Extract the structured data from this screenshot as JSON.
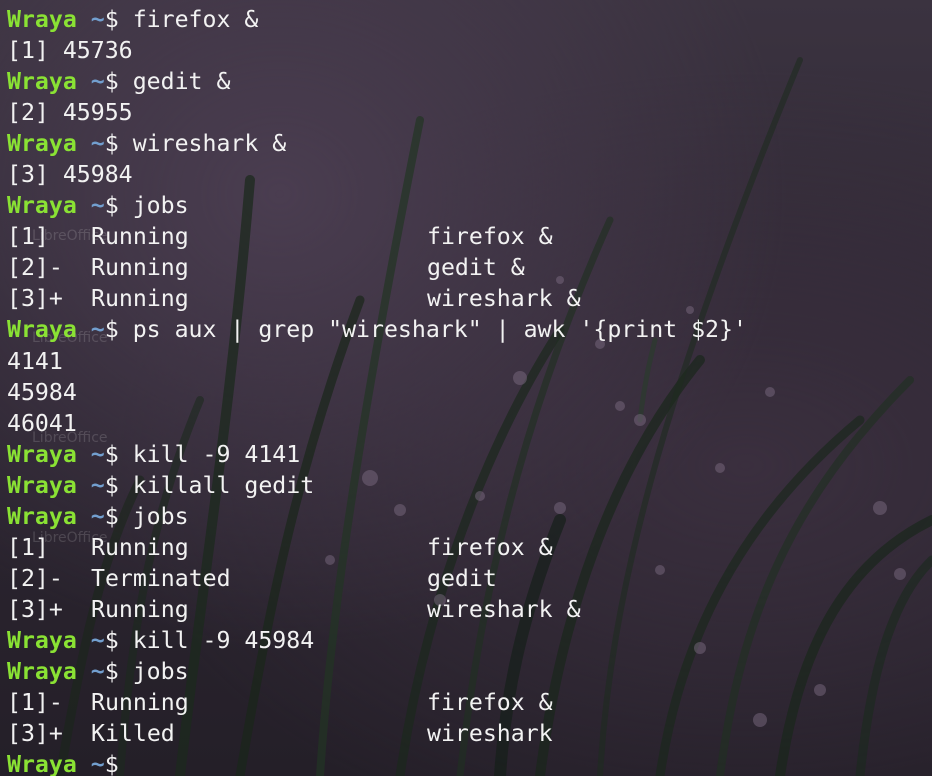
{
  "terminal": {
    "prompt_user": "Wraya",
    "prompt_dir": "~",
    "prompt_symbol": "$",
    "colors": {
      "user": "#8ae234",
      "dir": "#729fcf",
      "text": "#f2f2f2"
    },
    "lines": [
      {
        "type": "cmd",
        "text": "firefox &"
      },
      {
        "type": "out",
        "text": "[1] 45736"
      },
      {
        "type": "cmd",
        "text": "gedit &"
      },
      {
        "type": "out",
        "text": "[2] 45955"
      },
      {
        "type": "cmd",
        "text": "wireshark &"
      },
      {
        "type": "out",
        "text": "[3] 45984"
      },
      {
        "type": "cmd",
        "text": "jobs"
      },
      {
        "type": "job",
        "id": "[1]",
        "state": "Running",
        "command": "firefox &"
      },
      {
        "type": "job",
        "id": "[2]-",
        "state": "Running",
        "command": "gedit &"
      },
      {
        "type": "job",
        "id": "[3]+",
        "state": "Running",
        "command": "wireshark &"
      },
      {
        "type": "cmd",
        "text": "ps aux | grep \"wireshark\" | awk '{print $2}'"
      },
      {
        "type": "out",
        "text": "4141"
      },
      {
        "type": "out",
        "text": "45984"
      },
      {
        "type": "out",
        "text": "46041"
      },
      {
        "type": "cmd",
        "text": "kill -9 4141"
      },
      {
        "type": "cmd",
        "text": "killall gedit"
      },
      {
        "type": "cmd",
        "text": "jobs"
      },
      {
        "type": "job",
        "id": "[1]",
        "state": "Running",
        "command": "firefox &"
      },
      {
        "type": "job",
        "id": "[2]-",
        "state": "Terminated",
        "command": "gedit"
      },
      {
        "type": "job",
        "id": "[3]+",
        "state": "Running",
        "command": "wireshark &"
      },
      {
        "type": "cmd",
        "text": "kill -9 45984"
      },
      {
        "type": "cmd",
        "text": "jobs"
      },
      {
        "type": "job",
        "id": "[1]-",
        "state": "Running",
        "command": "firefox &"
      },
      {
        "type": "job",
        "id": "[3]+",
        "state": "Killed",
        "command": "wireshark"
      },
      {
        "type": "prompt",
        "text": ""
      }
    ]
  },
  "desktop": {
    "icon_labels": [
      "LibreOffice",
      "LibreOffice",
      "LibreOffice",
      "LibreOffice"
    ]
  }
}
